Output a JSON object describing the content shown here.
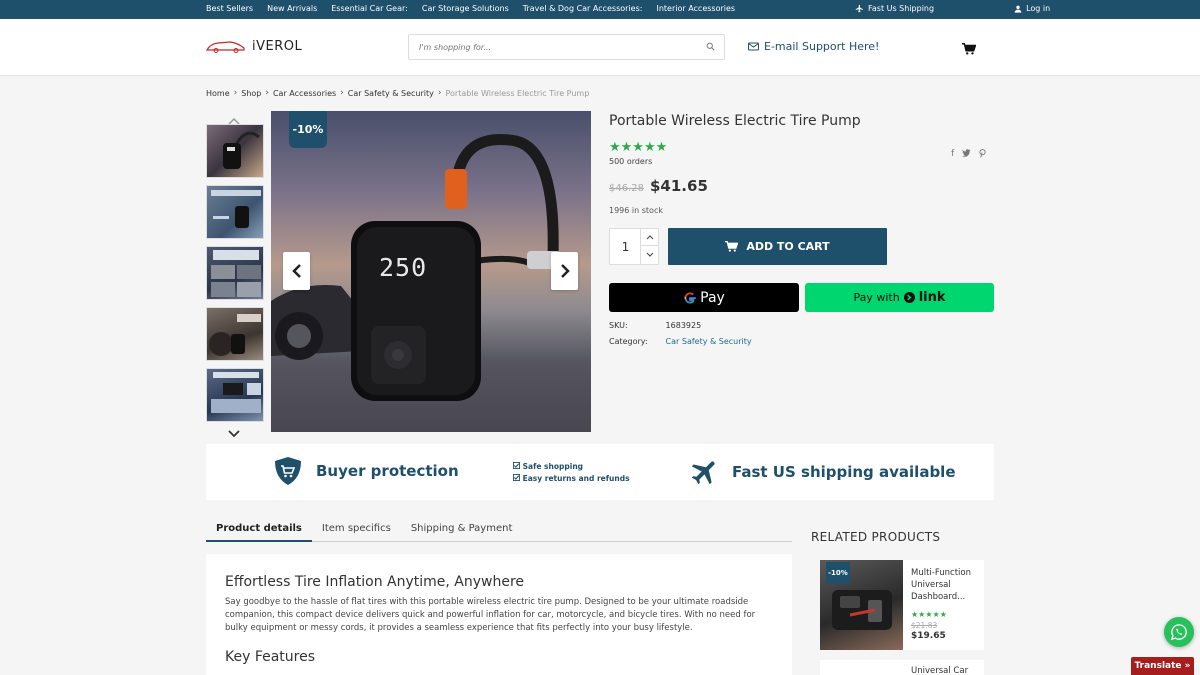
{
  "topbar": {
    "links": [
      "Best Sellers",
      "New Arrivals",
      "Essential Car Gear:",
      "Car Storage Solutions",
      "Travel & Dog Car Accessories:",
      "Interior Accessories"
    ],
    "shipping": "Fast Us Shipping",
    "login": "Log in"
  },
  "header": {
    "logo": "iVEROL",
    "search_placeholder": "I'm shopping for...",
    "email_support": "E-mail Support Here!"
  },
  "breadcrumb": {
    "items": [
      "Home",
      "Shop",
      "Car Accessories",
      "Car Safety & Security"
    ],
    "current": "Portable Wireless Electric Tire Pump"
  },
  "gallery": {
    "discount": "-10%",
    "display_reading": "250"
  },
  "product": {
    "title": "Portable Wireless Electric Tire Pump",
    "rating": 5,
    "stars": "★★★★★",
    "orders": "500 orders",
    "old_price": "$46.28",
    "price": "$41.65",
    "stock": "1996 in stock",
    "quantity": "1",
    "add_to_cart": "ADD TO CART",
    "gpay_label": "Pay",
    "link_pay_prefix": "Pay with",
    "link_pay_brand": "link",
    "sku_label": "SKU:",
    "sku_value": "1683925",
    "category_label": "Category:",
    "category_value": "Car Safety & Security"
  },
  "benefits": {
    "buyer_protection": "Buyer protection",
    "safe_shopping": "Safe shopping",
    "easy_returns": "Easy returns and refunds",
    "fast_shipping": "Fast US shipping available"
  },
  "tabs": [
    "Product details",
    "Item specifics",
    "Shipping & Payment"
  ],
  "details": {
    "heading": "Effortless Tire Inflation Anytime, Anywhere",
    "body": "Say goodbye to the hassle of flat tires with this portable wireless electric tire pump. Designed to be your ultimate roadside companion, this compact device delivers quick and powerful inflation for car, motorcycle, and bicycle tires. With no need for bulky equipment or messy cords, it provides a seamless experience that fits perfectly into your busy lifestyle.",
    "features_heading": "Key Features"
  },
  "related": {
    "title": "RELATED PRODUCTS",
    "items": [
      {
        "badge": "-10%",
        "name_lines": [
          "Multi-Function",
          "Universal",
          "Dashboard..."
        ],
        "stars": "★★★★★",
        "old_price": "$21.83",
        "price": "$19.65"
      },
      {
        "name": "Universal Car"
      }
    ]
  },
  "floating": {
    "translate": "Translate »"
  },
  "colors": {
    "brand": "#1e4f6b",
    "stars": "#2eaa4a",
    "link_pay": "#00d66f",
    "whatsapp": "#27c15c",
    "translate": "#a51d1d"
  }
}
